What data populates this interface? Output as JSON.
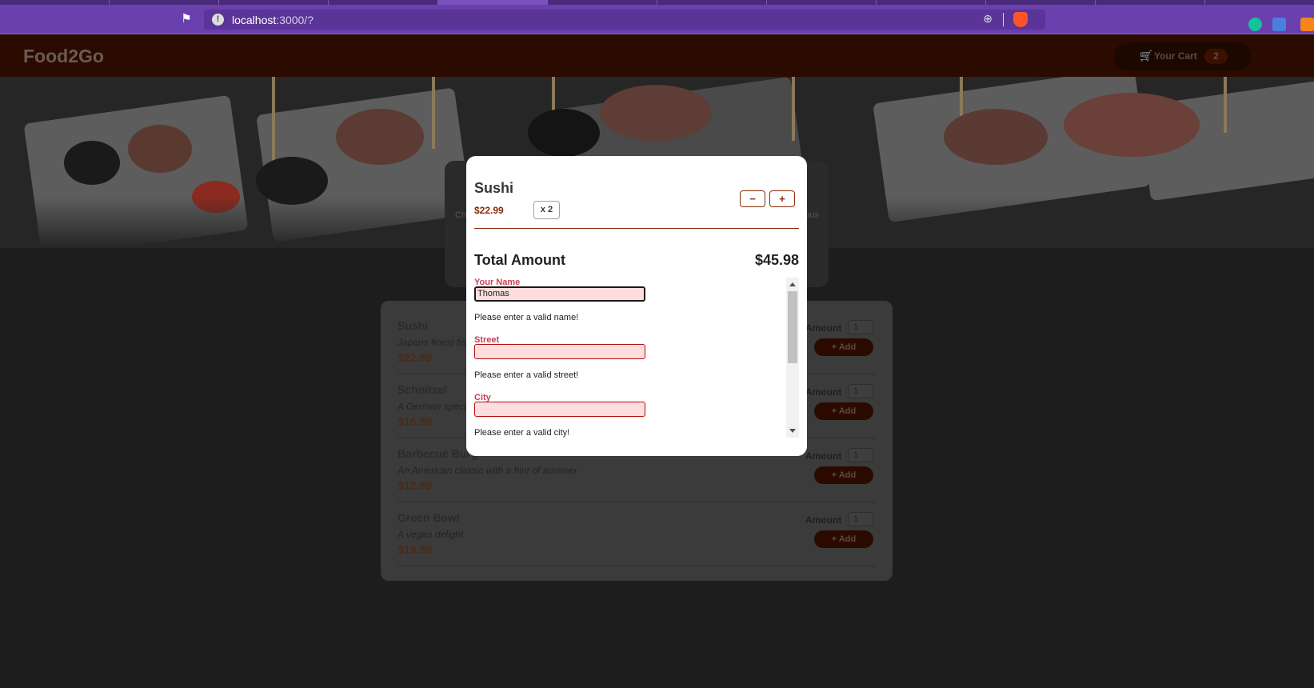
{
  "browser": {
    "url_host": "localhost",
    "url_path": ":3000/?",
    "info_icon": "info-icon",
    "colors": {
      "toolbar": "#6a3fae",
      "tabstrip": "#4a2a7a"
    }
  },
  "header": {
    "brand": "Food2Go",
    "cart_label": "Your Cart",
    "cart_count": "2",
    "cart_icon": "cart-icon"
  },
  "summary": {
    "left_text": "Ch",
    "right_text": "ous"
  },
  "meals": [
    {
      "name": "Sushi",
      "description": "Japans finest fish",
      "price": "$22.99",
      "amount_label": "Amount",
      "amount": "1",
      "add_label": "+ Add"
    },
    {
      "name": "Schnitzel",
      "description": "A German special",
      "price": "$16.50",
      "amount_label": "Amount",
      "amount": "1",
      "add_label": "+ Add"
    },
    {
      "name": "Barbecue Burg",
      "description": "An American classic with a hint of summer",
      "price": "$12.99",
      "amount_label": "Amount",
      "amount": "1",
      "add_label": "+ Add"
    },
    {
      "name": "Green Bowl",
      "description": "A vegan delight",
      "price": "$18.50",
      "amount_label": "Amount",
      "amount": "1",
      "add_label": "+ Add"
    }
  ],
  "modal": {
    "cart_item": {
      "name": "Sushi",
      "price": "$22.99",
      "quantity": "x 2",
      "minus_label": "−",
      "plus_label": "+"
    },
    "total_label": "Total Amount",
    "total_value": "$45.98",
    "form": {
      "name_label": "Your Name",
      "name_value": "Thomas",
      "name_error": "Please enter a valid name!",
      "street_label": "Street",
      "street_value": "",
      "street_error": "Please enter a valid street!",
      "city_label": "City",
      "city_value": "",
      "city_error": "Please enter a valid city!"
    },
    "colors": {
      "accent": "#8a2b06",
      "invalid_label": "#ca3e51",
      "invalid_bg": "#fddddd"
    }
  }
}
